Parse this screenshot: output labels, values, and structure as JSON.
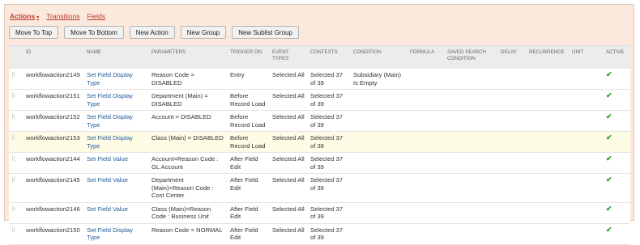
{
  "tabs": [
    {
      "label": "Actions",
      "active": true
    },
    {
      "label": "Transitions",
      "active": false
    },
    {
      "label": "Fields",
      "active": false
    }
  ],
  "buttons": {
    "move_top": "Move To Top",
    "move_bottom": "Move To Bottom",
    "new_action": "New Action",
    "new_group": "New Group",
    "new_sublist_group": "New Sublist Group"
  },
  "headers": {
    "id": "ID",
    "name": "NAME",
    "parameters": "PARAMETERS",
    "trigger_on": "TRIGGER ON",
    "event_types": "EVENT TYPES",
    "contexts": "CONTEXTS",
    "condition": "CONDITION",
    "formula": "FORMULA",
    "saved_search": "SAVED SEARCH CONDITION",
    "delay": "DELAY",
    "recurrence": "RECURRENCE",
    "unit": "UNIT",
    "active": "ACTIVE"
  },
  "rows": [
    {
      "id": "workflowaction2149",
      "name": "Set Field Display Type",
      "params": "Reason Code = DISABLED",
      "trigger": "Entry",
      "events": "Selected All",
      "contexts": "Selected 37 of 39",
      "condition": "Subsidiary (Main) Is Empty"
    },
    {
      "id": "workflowaction2151",
      "name": "Set Field Display Type",
      "params": "Department (Main) = DISABLED",
      "trigger": "Before Record Load",
      "events": "Selected All",
      "contexts": "Selected 37 of 39",
      "condition": ""
    },
    {
      "id": "workflowaction2152",
      "name": "Set Field Display Type",
      "params": "Account = DISABLED",
      "trigger": "Before Record Load",
      "events": "Selected All",
      "contexts": "Selected 37 of 39",
      "condition": ""
    },
    {
      "id": "workflowaction2153",
      "name": "Set Field Display Type",
      "params": "Class (Main) = DISABLED",
      "trigger": "Before Record Load",
      "events": "Selected All",
      "contexts": "Selected 37 of 39",
      "condition": ""
    },
    {
      "id": "workflowaction2144",
      "name": "Set Field Value",
      "params": "Account=Reason Code : GL Account",
      "trigger": "After Field Edit",
      "events": "Selected All",
      "contexts": "Selected 37 of 39",
      "condition": ""
    },
    {
      "id": "workflowaction2145",
      "name": "Set Field Value",
      "params": "Department (Main)=Reason Code : Cost Center",
      "trigger": "After Field Edit",
      "events": "Selected All",
      "contexts": "Selected 37 of 39",
      "condition": ""
    },
    {
      "id": "workflowaction2146",
      "name": "Set Field Value",
      "params": "Class (Main)=Reason Code : Business Unit",
      "trigger": "After Field Edit",
      "events": "Selected All",
      "contexts": "Selected 37 of 39",
      "condition": ""
    },
    {
      "id": "workflowaction2150",
      "name": "Set Field Display Type",
      "params": "Reason Code = NORMAL",
      "trigger": "After Field Edit",
      "events": "Selected All",
      "contexts": "Selected 37 of 39",
      "condition": ""
    }
  ],
  "icons": {
    "drag": "drag-handle-icon",
    "active": "checkmark-icon",
    "tab_caret": "caret-down-icon"
  },
  "colors": {
    "tab_text": "#c0392b",
    "link": "#1f5c99",
    "frame_bg": "#fbe9de",
    "check": "#2b9a2b",
    "highlight_row": "#fffce6"
  }
}
